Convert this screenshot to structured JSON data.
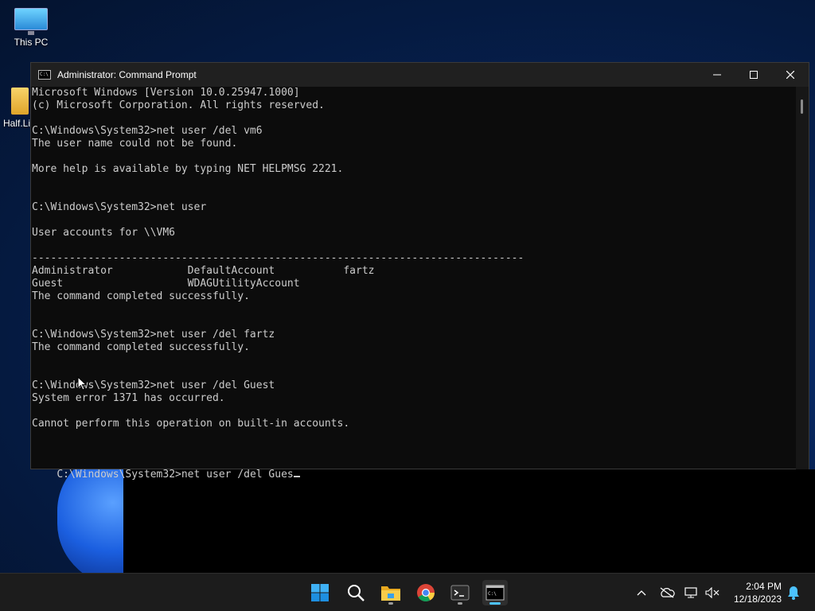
{
  "desktop": {
    "icons": [
      {
        "label": "This PC"
      },
      {
        "label": "Half.Li"
      }
    ]
  },
  "window": {
    "title": "Administrator: Command Prompt",
    "icon_glyph": "C:\\",
    "controls": {
      "minimize": "─",
      "maximize": "☐",
      "close": "✕"
    }
  },
  "console": {
    "lines": [
      "Microsoft Windows [Version 10.0.25947.1000]",
      "(c) Microsoft Corporation. All rights reserved.",
      "",
      "C:\\Windows\\System32>net user /del vm6",
      "The user name could not be found.",
      "",
      "More help is available by typing NET HELPMSG 2221.",
      "",
      "",
      "C:\\Windows\\System32>net user",
      "",
      "User accounts for \\\\VM6",
      "",
      "-------------------------------------------------------------------------------",
      "Administrator            DefaultAccount           fartz",
      "Guest                    WDAGUtilityAccount",
      "The command completed successfully.",
      "",
      "",
      "C:\\Windows\\System32>net user /del fartz",
      "The command completed successfully.",
      "",
      "",
      "C:\\Windows\\System32>net user /del Guest",
      "System error 1371 has occurred.",
      "",
      "Cannot perform this operation on built-in accounts.",
      "",
      ""
    ],
    "prompt": "C:\\Windows\\System32>",
    "current_input": "net user /del Gues"
  },
  "taskbar": {
    "apps": [
      "start-icon",
      "search-icon",
      "file-explorer-icon",
      "chrome-icon",
      "terminal-icon",
      "command-prompt-icon"
    ],
    "tray": {
      "chevron": "^",
      "time": "2:04 PM",
      "date": "12/18/2023"
    }
  },
  "colors": {
    "console_bg": "#0c0c0c",
    "console_text": "#cccccc",
    "titlebar": "#202020",
    "taskbar": "#1c1c1c",
    "accent": "#4cc2ff"
  }
}
